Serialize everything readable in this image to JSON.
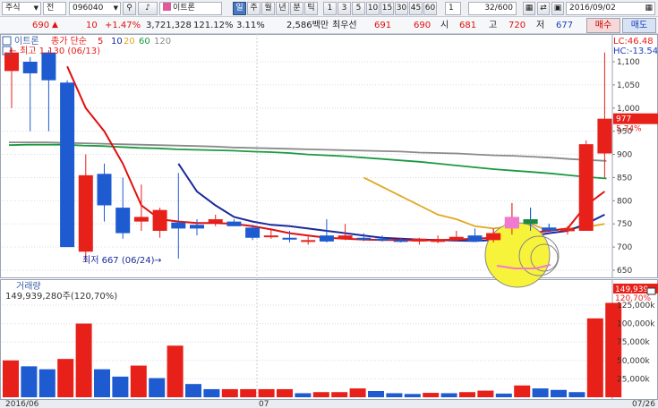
{
  "toolbar": {
    "market_select": "주식",
    "market_arrow": "▼",
    "type_select": "전",
    "code_input": "096040",
    "code_arrow": "▼",
    "stock_name": "이트론",
    "periods": [
      "일",
      "주",
      "월",
      "년",
      "분",
      "틱"
    ],
    "active_period": "일",
    "intervals": [
      "1",
      "3",
      "5",
      "10",
      "15",
      "30",
      "45",
      "60"
    ],
    "interval_select": "1",
    "count_display": "32/600",
    "date_display": "2016/09/02"
  },
  "quote": {
    "price": "690",
    "change_arrow": "▲",
    "change": "10",
    "change_pct": "+1.47%",
    "volume": "3,721,328",
    "vol_ratio": "121.12%",
    "turnover": "3.11%",
    "amount": "2,586백만",
    "bid_label": "최우선",
    "best_ask": "691",
    "best_bid": "690",
    "open_label": "시",
    "open": "681",
    "high_label": "고",
    "high": "720",
    "low_label": "저",
    "low": "677",
    "buy_label": "매수",
    "sell_label": "매도"
  },
  "chart": {
    "legend_name": "이트론",
    "legend_ma_label": "종가 단순",
    "ma_periods": [
      "5",
      "10",
      "20",
      "60",
      "120"
    ],
    "ma_colors": [
      "#e01010",
      "#1a2a9a",
      "#e0a820",
      "#1a9a40",
      "#8a8a8a"
    ],
    "high_annotation": "최고 1,130 (06/13)",
    "low_annotation": "최저 667 (06/24)",
    "lc_label": "LC:46.48",
    "hc_label": "HC:-13.54",
    "last_price": "977",
    "last_pct": "5.74%",
    "price_ticks": [
      "1,100",
      "1,050",
      "1,000",
      "950",
      "900",
      "850",
      "800",
      "750",
      "700",
      "650"
    ],
    "volume_title": "거래량",
    "volume_value": "149,939,280주(120,70%)",
    "last_volume": "149,939",
    "last_volume_pct": "120,70%",
    "volume_ticks": [
      "125,000k",
      "100,000k",
      "75,000k",
      "50,000k",
      "25,000k"
    ],
    "date_labels": [
      "2016/06",
      "07",
      "07/26"
    ]
  },
  "chart_data": {
    "type": "candlestick",
    "price_range": [
      625,
      1140
    ],
    "candles": [
      {
        "o": 1080,
        "h": 1130,
        "l": 1000,
        "c": 1120
      },
      {
        "o": 1100,
        "h": 1110,
        "l": 950,
        "c": 1075
      },
      {
        "o": 1120,
        "h": 1125,
        "l": 950,
        "c": 1060
      },
      {
        "o": 1055,
        "h": 1060,
        "l": 700,
        "c": 700
      },
      {
        "o": 690,
        "h": 900,
        "l": 667,
        "c": 855
      },
      {
        "o": 858,
        "h": 880,
        "l": 755,
        "c": 790
      },
      {
        "o": 785,
        "h": 850,
        "l": 718,
        "c": 730
      },
      {
        "o": 755,
        "h": 835,
        "l": 735,
        "c": 765
      },
      {
        "o": 735,
        "h": 785,
        "l": 720,
        "c": 780
      },
      {
        "o": 753,
        "h": 860,
        "l": 675,
        "c": 740
      },
      {
        "o": 748,
        "h": 760,
        "l": 725,
        "c": 740
      },
      {
        "o": 753,
        "h": 770,
        "l": 745,
        "c": 760
      },
      {
        "o": 755,
        "h": 760,
        "l": 745,
        "c": 745
      },
      {
        "o": 742,
        "h": 748,
        "l": 715,
        "c": 720
      },
      {
        "o": 725,
        "h": 740,
        "l": 718,
        "c": 725
      },
      {
        "o": 720,
        "h": 735,
        "l": 710,
        "c": 718
      },
      {
        "o": 713,
        "h": 725,
        "l": 705,
        "c": 715
      },
      {
        "o": 725,
        "h": 760,
        "l": 710,
        "c": 712
      },
      {
        "o": 718,
        "h": 750,
        "l": 715,
        "c": 725
      },
      {
        "o": 720,
        "h": 730,
        "l": 713,
        "c": 718
      },
      {
        "o": 718,
        "h": 725,
        "l": 712,
        "c": 715
      },
      {
        "o": 715,
        "h": 720,
        "l": 710,
        "c": 712
      },
      {
        "o": 712,
        "h": 720,
        "l": 705,
        "c": 718
      },
      {
        "o": 713,
        "h": 725,
        "l": 708,
        "c": 715
      },
      {
        "o": 715,
        "h": 735,
        "l": 712,
        "c": 722
      },
      {
        "o": 725,
        "h": 740,
        "l": 712,
        "c": 712
      },
      {
        "o": 715,
        "h": 740,
        "l": 710,
        "c": 730
      },
      {
        "o": 740,
        "h": 795,
        "l": 727,
        "c": 765
      },
      {
        "o": 760,
        "h": 785,
        "l": 735,
        "c": 750
      },
      {
        "o": 742,
        "h": 750,
        "l": 735,
        "c": 735
      },
      {
        "o": 735,
        "h": 745,
        "l": 727,
        "c": 740
      },
      {
        "o": 735,
        "h": 930,
        "l": 735,
        "c": 922
      },
      {
        "o": 902,
        "h": 1120,
        "l": 850,
        "c": 977
      }
    ],
    "ma5": [
      null,
      null,
      null,
      1090,
      1000,
      950,
      880,
      790,
      760,
      755,
      752,
      752,
      750,
      745,
      738,
      730,
      725,
      720,
      718,
      716,
      715,
      715,
      714,
      715,
      716,
      718,
      720,
      725,
      730,
      735,
      740,
      790,
      820
    ],
    "ma10": [
      null,
      null,
      null,
      null,
      null,
      null,
      null,
      null,
      null,
      880,
      820,
      790,
      765,
      755,
      748,
      745,
      740,
      735,
      730,
      725,
      720,
      718,
      716,
      715,
      714,
      713,
      715,
      720,
      723,
      730,
      735,
      750,
      770
    ],
    "ma20": [
      null,
      null,
      null,
      null,
      null,
      null,
      null,
      null,
      null,
      null,
      null,
      null,
      null,
      null,
      null,
      null,
      null,
      null,
      null,
      850,
      830,
      810,
      790,
      770,
      760,
      745,
      740,
      745,
      750,
      735,
      740,
      743,
      750
    ],
    "ma60": [
      920,
      921,
      921,
      921,
      919,
      918,
      916,
      914,
      913,
      911,
      910,
      909,
      908,
      906,
      905,
      903,
      900,
      898,
      896,
      893,
      890,
      887,
      884,
      880,
      876,
      872,
      868,
      865,
      862,
      859,
      855,
      851,
      848
    ],
    "ma120": [
      926,
      926,
      926,
      925,
      924,
      923,
      922,
      921,
      920,
      919,
      918,
      917,
      915,
      914,
      913,
      912,
      911,
      910,
      909,
      908,
      907,
      906,
      904,
      903,
      902,
      900,
      898,
      897,
      895,
      893,
      890,
      888,
      886
    ],
    "volumes": [
      50000,
      42000,
      38000,
      52000,
      100000,
      38000,
      28000,
      43000,
      26000,
      70000,
      18000,
      11000,
      11000,
      11000,
      11000,
      11000,
      5500,
      7000,
      7000,
      12000,
      8500,
      5500,
      4500,
      6000,
      5500,
      7000,
      9000,
      5000,
      16000,
      12000,
      10000,
      7000,
      107000,
      128000
    ],
    "volume_range": [
      0,
      140000
    ]
  }
}
